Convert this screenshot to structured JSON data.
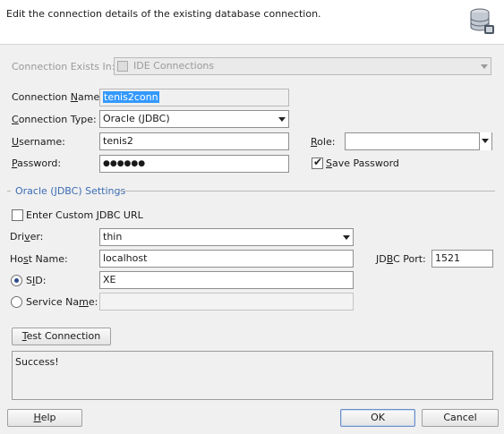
{
  "header": {
    "description": "Edit the connection details of the existing database connection.",
    "icon": "database-connection-icon"
  },
  "connection_exists_in": {
    "label": "Connection Exists In:",
    "value": "IDE Connections"
  },
  "connection_name": {
    "label_pre": "Connection ",
    "label_mn": "N",
    "label_post": "ame:",
    "value": "tenis2conn"
  },
  "connection_type": {
    "label_mn": "C",
    "label_post": "onnection Type:",
    "value": "Oracle (JDBC)"
  },
  "username": {
    "label_mn": "U",
    "label_post": "sername:",
    "value": "tenis2"
  },
  "role": {
    "label_mn": "R",
    "label_post": "ole:",
    "value": ""
  },
  "password": {
    "label_mn": "P",
    "label_post": "assword:",
    "value": "●●●●●●"
  },
  "save_password": {
    "label_mn": "S",
    "label_post": "ave Password",
    "checked": true
  },
  "section": {
    "title": "Oracle (JDBC) Settings"
  },
  "custom_jdbc": {
    "label_pre": "Enter Custom ",
    "label_mn": "J",
    "label_post": "DBC URL",
    "checked": false
  },
  "driver": {
    "label_pre": "Dri",
    "label_mn": "v",
    "label_post": "er:",
    "value": "thin"
  },
  "host_name": {
    "label_pre": "Ho",
    "label_mn": "s",
    "label_post": "t Name:",
    "value": "localhost"
  },
  "jdbc_port": {
    "label_pre": "JD",
    "label_mn": "B",
    "label_post": "C Port:",
    "value": "1521"
  },
  "sid": {
    "label_pre": "S",
    "label_mn": "I",
    "label_post": "D:",
    "value": "XE",
    "selected": true
  },
  "service_name": {
    "label_pre": "Service Na",
    "label_mn": "m",
    "label_post": "e:",
    "value": ""
  },
  "test_connection": {
    "label_mn": "T",
    "label_post": "est Connection"
  },
  "result": "Success!",
  "buttons": {
    "help": {
      "label_mn": "H",
      "label_post": "elp"
    },
    "ok": "OK",
    "cancel": "Cancel"
  }
}
